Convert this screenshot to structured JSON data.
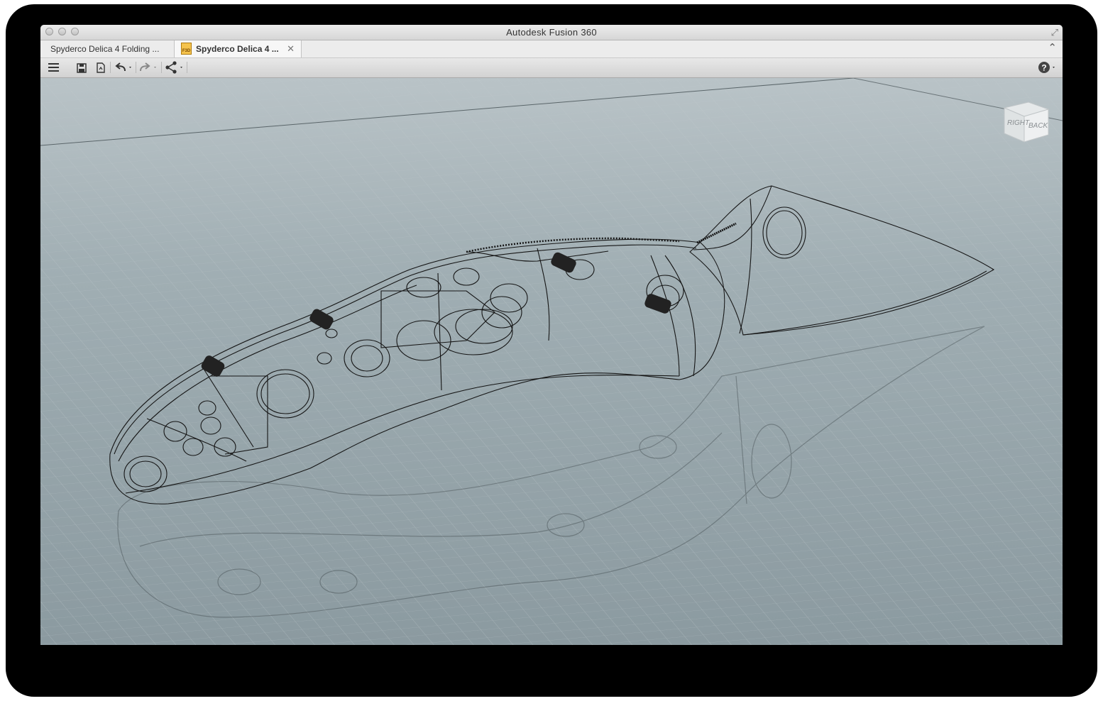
{
  "window": {
    "title": "Autodesk Fusion 360",
    "fullscreen_icon": "fullscreen-arrows-icon"
  },
  "tabs": [
    {
      "label": "Spyderco Delica 4 Folding ...",
      "active": false
    },
    {
      "label": "Spyderco Delica 4 ...",
      "active": true,
      "icon_text": "F3D"
    }
  ],
  "toolbar": {
    "icons": [
      "menu-icon",
      "save-icon",
      "export-icon",
      "undo-icon",
      "redo-icon",
      "share-icon",
      "help-icon"
    ]
  },
  "viewcube": {
    "faces": [
      "RIGHT",
      "BACK"
    ]
  },
  "colors": {
    "viewport_bg": "#8f9ea4",
    "grid_line": "#a8b4b9",
    "model_line": "#141414"
  }
}
